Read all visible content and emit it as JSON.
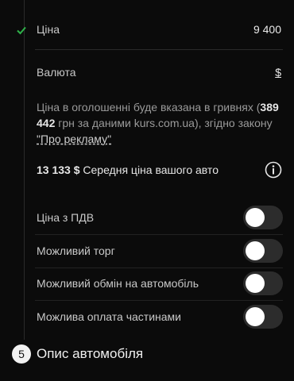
{
  "price": {
    "label": "Ціна",
    "value": "9 400"
  },
  "currency": {
    "label": "Валюта",
    "value": "$"
  },
  "note": {
    "before": "Ціна в оголошенні буде вказана в гривнях (",
    "uah_amount": "389 442",
    "middle": " грн за даними kurs.com.ua), згідно закону ",
    "link": "\"Про рекламу\""
  },
  "avg_price": {
    "amount": "13 133 $",
    "label": "Середня ціна вашого авто"
  },
  "options": [
    {
      "label": "Ціна з ПДВ",
      "on": false
    },
    {
      "label": "Можливий торг",
      "on": false
    },
    {
      "label": "Можливий обмін на автомобіль",
      "on": false
    },
    {
      "label": "Можлива оплата частинами",
      "on": false
    }
  ],
  "section5": {
    "number": "5",
    "title": "Опис автомобіля"
  },
  "colors": {
    "background": "#0b0b0b",
    "check": "#2fb24a",
    "toggle_track": "#2c2c2c"
  },
  "icons": [
    "check-icon",
    "info-icon"
  ]
}
